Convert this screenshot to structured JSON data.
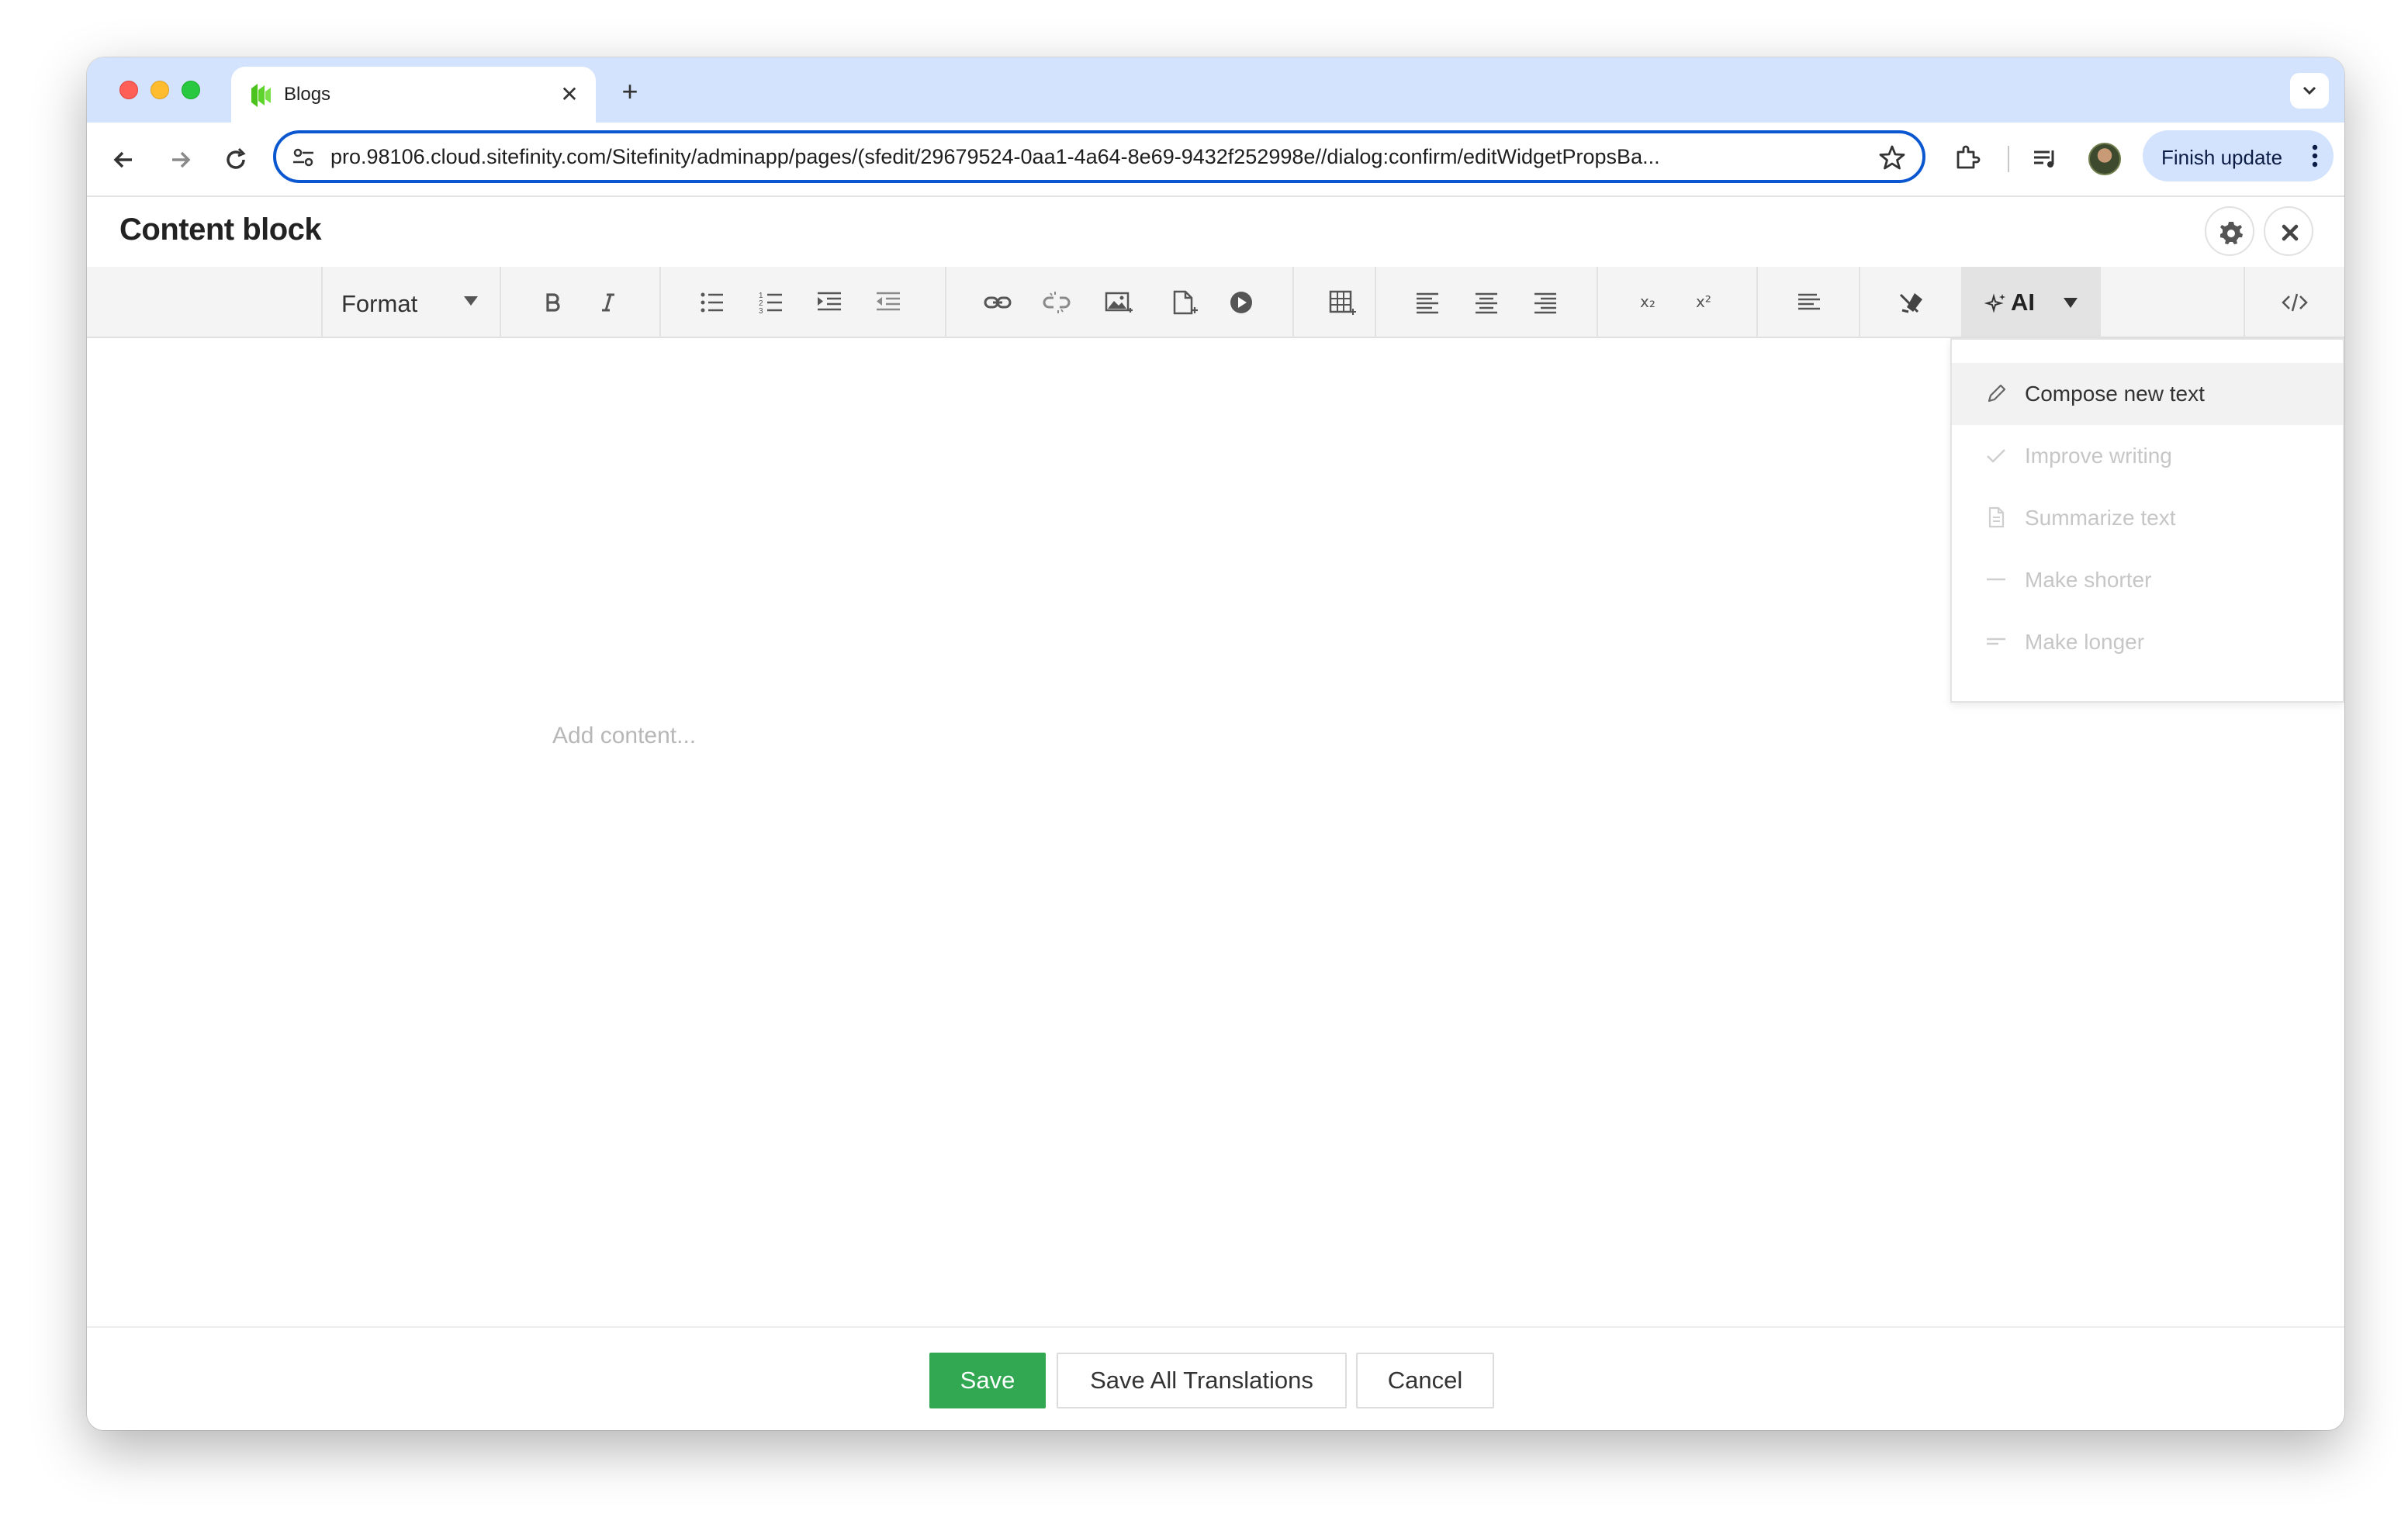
{
  "browser": {
    "tab_title": "Blogs",
    "url": "pro.98106.cloud.sitefinity.com/Sitefinity/adminapp/pages/(sfedit/29679524-0aa1-4a64-8e69-9432f252998e//dialog:confirm/editWidgetPropsBa...",
    "finish_update_label": "Finish update",
    "new_tab_symbol": "+",
    "close_tab_symbol": "✕"
  },
  "dialog": {
    "title": "Content block"
  },
  "toolbar": {
    "format_label": "Format",
    "ai_label": "AI",
    "subscript_label": "x₂",
    "superscript_label": "x²"
  },
  "editor": {
    "placeholder": "Add content..."
  },
  "ai_menu": {
    "items": [
      {
        "label": "Compose new text",
        "icon": "pencil-icon",
        "enabled": true
      },
      {
        "label": "Improve writing",
        "icon": "check-icon",
        "enabled": false
      },
      {
        "label": "Summarize text",
        "icon": "document-icon",
        "enabled": false
      },
      {
        "label": "Make shorter",
        "icon": "short-lines-icon",
        "enabled": false
      },
      {
        "label": "Make longer",
        "icon": "long-lines-icon",
        "enabled": false
      }
    ]
  },
  "footer": {
    "save_label": "Save",
    "save_all_label": "Save All Translations",
    "cancel_label": "Cancel"
  },
  "colors": {
    "accent_blue": "#0b57d0",
    "tabstrip": "#d3e3fd",
    "save_green": "#32a852",
    "favicon_green": "#4cc21c"
  }
}
